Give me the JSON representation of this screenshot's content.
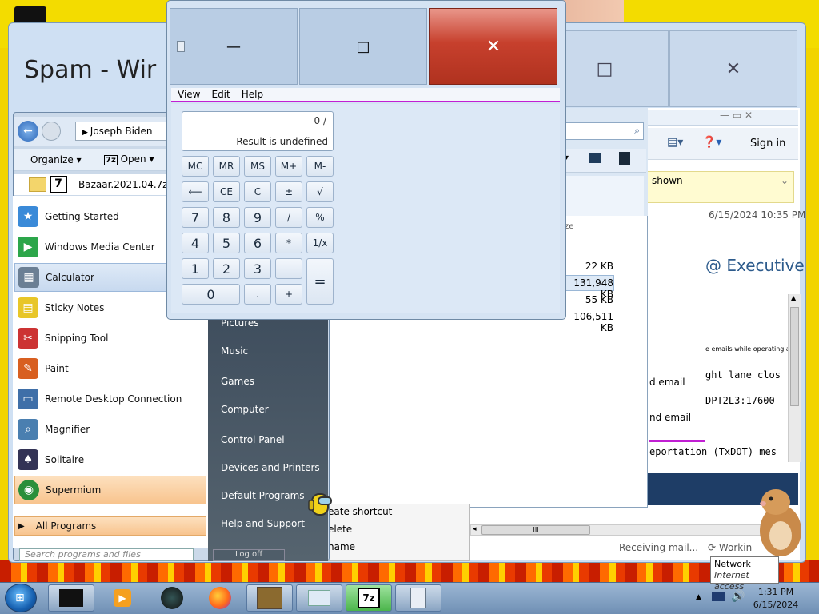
{
  "mail_window": {
    "title": "Spam - Wir",
    "maximize_symbol": "□",
    "close_symbol": "✕",
    "sign_in": "Sign in",
    "infobar_text": "shown",
    "date": "6/15/2024 10:35 PM",
    "subject_fragment": "@ Executive",
    "body_small": "e emails while operating a",
    "body_line1": "ght lane clos",
    "body_line2": "DPT2L3:17600",
    "body_line3": "eportation (TxDOT) mes",
    "forward_email_1": "d email",
    "forward_email_2": "nd email",
    "status_text": "Receiving mail...",
    "status_working": "Workin",
    "scroll_grip": "III"
  },
  "explorer": {
    "breadcrumb": "Joseph Biden",
    "organize": "Organize",
    "open": "Open",
    "file_name": "Bazaar.2021.04.7z",
    "size_header": "ze",
    "sizes": [
      "22 KB",
      "131,948 KB",
      "55 KB",
      "106,511 KB"
    ],
    "context_items": [
      "eate shortcut",
      "elete",
      "name"
    ]
  },
  "start_menu": {
    "programs": [
      {
        "label": "Getting Started",
        "icon": "getting-started-icon",
        "color": "#3a8ad8"
      },
      {
        "label": "Windows Media Center",
        "icon": "media-center-icon",
        "color": "#2ca64a"
      },
      {
        "label": "Calculator",
        "icon": "calculator-icon",
        "color": "#6b7f94"
      },
      {
        "label": "Sticky Notes",
        "icon": "sticky-notes-icon",
        "color": "#e8c628"
      },
      {
        "label": "Snipping Tool",
        "icon": "scissors-icon",
        "color": "#c33"
      },
      {
        "label": "Paint",
        "icon": "paint-icon",
        "color": "#d85f20"
      },
      {
        "label": "Remote Desktop Connection",
        "icon": "remote-desktop-icon",
        "color": "#3f6fa8"
      },
      {
        "label": "Magnifier",
        "icon": "magnifier-icon",
        "color": "#4a7fb0"
      },
      {
        "label": "Solitaire",
        "icon": "solitaire-icon",
        "color": "#335"
      },
      {
        "label": "Supermium",
        "icon": "supermium-icon",
        "color": "#2a8f3a"
      }
    ],
    "all_programs": "All Programs",
    "search_placeholder": "Search programs and files",
    "right_items": [
      "Pictures",
      "Music",
      "Games",
      "Computer",
      "Control Panel",
      "Devices and Printers",
      "Default Programs",
      "Help and Support"
    ],
    "log_off": "Log off"
  },
  "calculator": {
    "menu": [
      "View",
      "Edit",
      "Help"
    ],
    "expression": "0 /",
    "result": "Result is undefined",
    "minimize_symbol": "—",
    "restore_symbol": "□",
    "close_symbol": "✕",
    "keys": {
      "mc": "MC",
      "mr": "MR",
      "ms": "MS",
      "mplus": "M+",
      "mminus": "M-",
      "back": "⟵",
      "ce": "CE",
      "c": "C",
      "pm": "±",
      "sqrt": "√",
      "n7": "7",
      "n8": "8",
      "n9": "9",
      "div": "/",
      "pct": "%",
      "n4": "4",
      "n5": "5",
      "n6": "6",
      "mul": "*",
      "inv": "1/x",
      "n1": "1",
      "n2": "2",
      "n3": "3",
      "sub": "-",
      "eq": "=",
      "n0": "0",
      "dot": ".",
      "add": "+"
    }
  },
  "taskbar": {
    "time": "1:31 PM",
    "date": "6/15/2024",
    "tooltip_title": "Network",
    "tooltip_sub": "Internet access"
  }
}
